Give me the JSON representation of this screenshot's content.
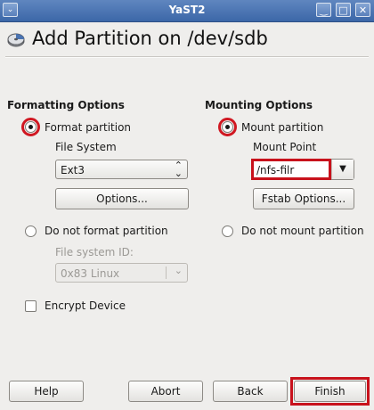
{
  "window": {
    "title": "YaST2"
  },
  "titlebar_buttons": {
    "minimize": "‿",
    "maximize": "□",
    "close": "✕",
    "menu": "⌄"
  },
  "heading": {
    "text": "Add Partition on /dev/sdb",
    "icon": "partition-disk-icon"
  },
  "formatting": {
    "title": "Formatting Options",
    "format_label": "Format partition",
    "format_selected": true,
    "file_system_label": "File System",
    "file_system_value": "Ext3",
    "options_button": "Options...",
    "no_format_label": "Do not format partition",
    "no_format_selected": false,
    "fs_id_label": "File system ID:",
    "fs_id_value": "0x83 Linux",
    "encrypt_label": "Encrypt Device",
    "encrypt_checked": false
  },
  "mounting": {
    "title": "Mounting Options",
    "mount_label": "Mount partition",
    "mount_selected": true,
    "mount_point_label": "Mount Point",
    "mount_point_value": "/nfs-filr",
    "fstab_button": "Fstab Options...",
    "no_mount_label": "Do not mount partition",
    "no_mount_selected": false
  },
  "buttons": {
    "help": "Help",
    "abort": "Abort",
    "back": "Back",
    "finish": "Finish"
  },
  "colors": {
    "titlebar": "#4a73b2",
    "highlight": "#c8121c",
    "background": "#efeeec"
  }
}
